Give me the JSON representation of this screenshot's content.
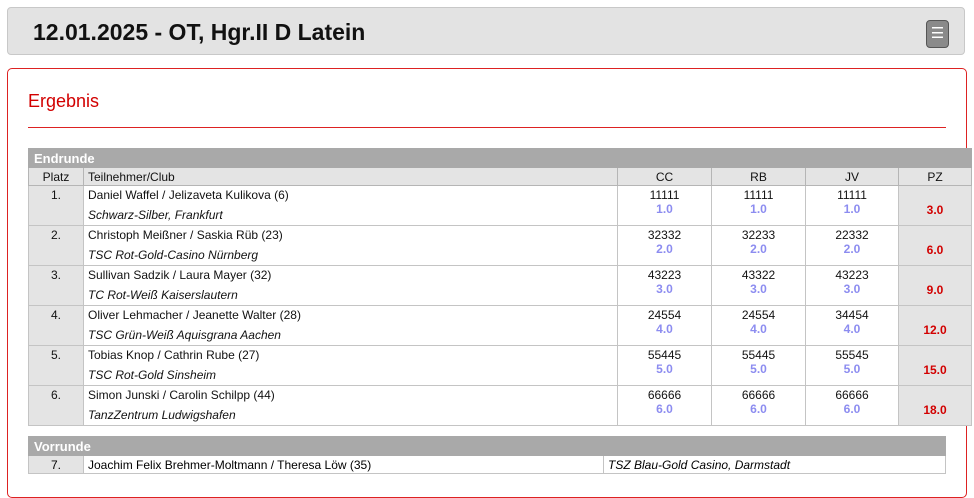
{
  "header": {
    "title": "12.01.2025 - OT, Hgr.II D Latein",
    "menu_icon": "☰"
  },
  "panel": {
    "title": "Ergebnis"
  },
  "final": {
    "section_label": "Endrunde",
    "columns": {
      "place": "Platz",
      "participant": "Teilnehmer/Club",
      "cc": "CC",
      "rb": "RB",
      "jv": "JV",
      "pz": "PZ"
    },
    "rows": [
      {
        "place": "1.",
        "couple": "Daniel Waffel / Jelizaveta Kulikova (6)",
        "club": "Schwarz-Silber, Frankfurt",
        "cc_marks": "11111",
        "cc_score": "1.0",
        "rb_marks": "11111",
        "rb_score": "1.0",
        "jv_marks": "11111",
        "jv_score": "1.0",
        "pz": "3.0"
      },
      {
        "place": "2.",
        "couple": "Christoph Meißner / Saskia Rüb (23)",
        "club": "TSC Rot-Gold-Casino Nürnberg",
        "cc_marks": "32332",
        "cc_score": "2.0",
        "rb_marks": "32233",
        "rb_score": "2.0",
        "jv_marks": "22332",
        "jv_score": "2.0",
        "pz": "6.0"
      },
      {
        "place": "3.",
        "couple": "Sullivan Sadzik / Laura Mayer (32)",
        "club": "TC Rot-Weiß Kaiserslautern",
        "cc_marks": "43223",
        "cc_score": "3.0",
        "rb_marks": "43322",
        "rb_score": "3.0",
        "jv_marks": "43223",
        "jv_score": "3.0",
        "pz": "9.0"
      },
      {
        "place": "4.",
        "couple": "Oliver Lehmacher / Jeanette Walter (28)",
        "club": "TSC Grün-Weiß Aquisgrana Aachen",
        "cc_marks": "24554",
        "cc_score": "4.0",
        "rb_marks": "24554",
        "rb_score": "4.0",
        "jv_marks": "34454",
        "jv_score": "4.0",
        "pz": "12.0"
      },
      {
        "place": "5.",
        "couple": "Tobias Knop / Cathrin Rube (27)",
        "club": "TSC Rot-Gold Sinsheim",
        "cc_marks": "55445",
        "cc_score": "5.0",
        "rb_marks": "55445",
        "rb_score": "5.0",
        "jv_marks": "55545",
        "jv_score": "5.0",
        "pz": "15.0"
      },
      {
        "place": "6.",
        "couple": "Simon Junski / Carolin Schilpp (44)",
        "club": "TanzZentrum Ludwigshafen",
        "cc_marks": "66666",
        "cc_score": "6.0",
        "rb_marks": "66666",
        "rb_score": "6.0",
        "jv_marks": "66666",
        "jv_score": "6.0",
        "pz": "18.0"
      }
    ]
  },
  "prelim": {
    "section_label": "Vorrunde",
    "rows": [
      {
        "place": "7.",
        "couple": "Joachim Felix Brehmer-Moltmann / Theresa Löw (35)",
        "club": "TSZ Blau-Gold Casino, Darmstadt"
      }
    ]
  }
}
